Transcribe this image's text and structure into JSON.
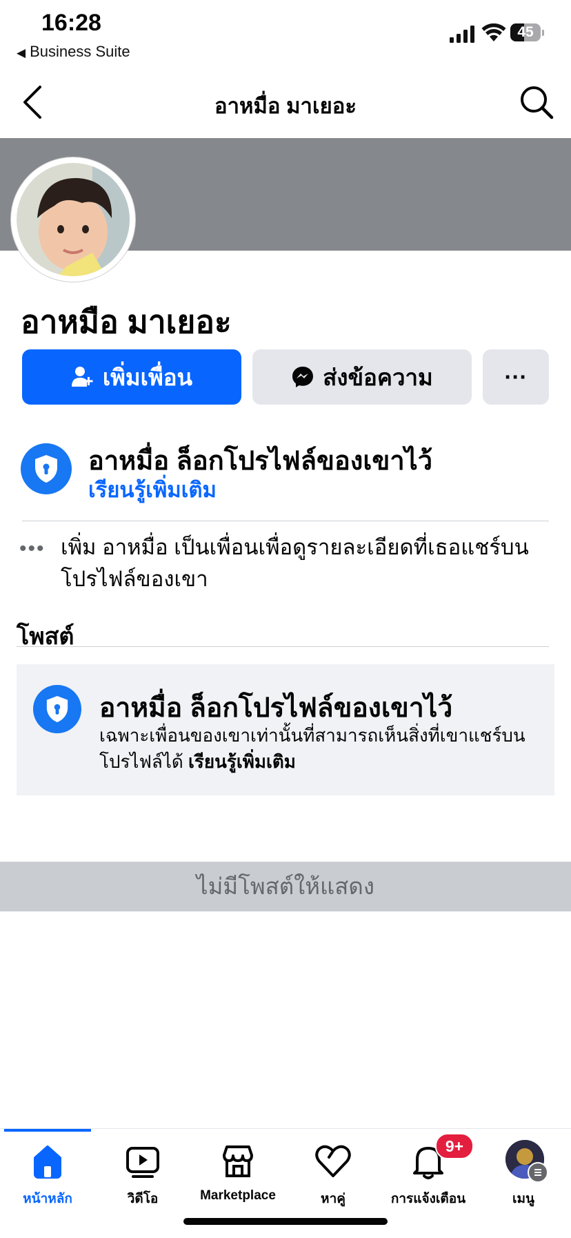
{
  "status_bar": {
    "time": "16:28",
    "back_app_label": "Business Suite",
    "battery_level": "45",
    "battery_fraction": 0.45
  },
  "nav": {
    "title": "อาหมื่อ มาเยอะ",
    "back_icon": "chevron-left-icon",
    "search_icon": "search-icon"
  },
  "profile": {
    "name": "อาหมือ มาเยอะ"
  },
  "actions": {
    "add_friend": "เพิ่มเพื่อน",
    "message": "ส่งข้อความ",
    "more": "···"
  },
  "lock_notice": {
    "title": "อาหมื่อ ล็อกโปรไฟล์ของเขาไว้",
    "link": "เรียนรู้เพิ่มเติม"
  },
  "info": {
    "text": "เพิ่ม อาหมื่อ เป็นเพื่อนเพื่อดูรายละเอียดที่เธอแชร์บนโปรไฟล์ของเขา"
  },
  "posts": {
    "heading": "โพสต์",
    "card_title": "อาหมื่อ ล็อกโปรไฟล์ของเขาไว้",
    "card_desc": "เฉพาะเพื่อนของเขาเท่านั้นที่สามารถเห็นสิ่งที่เขาแชร์บนโปรไฟล์ได้",
    "card_link": "เรียนรู้เพิ่มเติม",
    "empty": "ไม่มีโพสต์ให้แสดง"
  },
  "tabbar": {
    "tabs": [
      {
        "label": "หน้าหลัก",
        "icon": "home-icon",
        "active": true
      },
      {
        "label": "วิดีโอ",
        "icon": "video-icon",
        "active": false
      },
      {
        "label": "Marketplace",
        "icon": "marketplace-icon",
        "active": false
      },
      {
        "label": "หาคู่",
        "icon": "heart-icon",
        "active": false
      },
      {
        "label": "การแจ้งเตือน",
        "icon": "bell-icon",
        "active": false,
        "badge": "9+"
      },
      {
        "label": "เมนู",
        "icon": "menu-avatar",
        "active": false
      }
    ]
  },
  "colors": {
    "accent": "#0866ff",
    "badge": "#e41e3f",
    "cover": "#85888c"
  }
}
